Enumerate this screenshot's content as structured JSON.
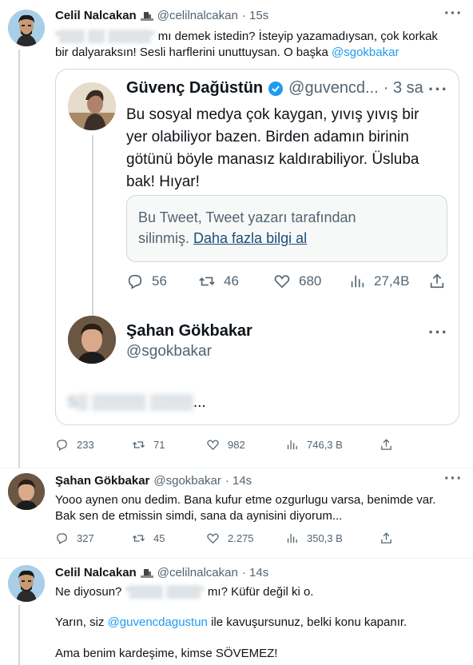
{
  "tweet1": {
    "name": "Celil Nalcakan",
    "handle": "@celilnalcakan",
    "time": "· 15s",
    "text_quote_blur": "“▒▒▒ ▒▒ ▒▒▒▒▒”",
    "text_part1": " mı demek istedin? İsteyip yazamadıysan, çok korkak",
    "text_part2": "bir dalyaraksın! Sesli harflerini unuttuysan. O başka ",
    "mention": "@sgokbakar",
    "stats": {
      "replies": "233",
      "retweets": "71",
      "likes": "982",
      "views": "746,3 B"
    }
  },
  "quoted": {
    "name": "Güvenç Dağüstün",
    "handle": "@guvencd...",
    "time": "· 3 sa",
    "text_lines": [
      "Bu sosyal medya çok kaygan, yıvış yıvış bir",
      "yer olabiliyor bazen. Birden adamın birinin",
      "götünü böyle manasız kaldırabiliyor. Üsluba",
      "bak! Hıyar!"
    ],
    "deleted_line1": "Bu Tweet, Tweet yazarı tarafından",
    "deleted_line2": "silinmiş. ",
    "deleted_link": "Daha fazla bilgi al",
    "stats": {
      "replies": "56",
      "retweets": "46",
      "likes": "680",
      "views": "27,4B"
    },
    "reply_name": "Şahan Gökbakar",
    "reply_handle": "@sgokbakar",
    "reply_text_blur": "S▒ ▒▒▒▒▒ ▒▒▒▒",
    "reply_text_end": "..."
  },
  "tweet2": {
    "name": "Şahan Gökbakar",
    "handle": "@sgokbakar",
    "time": "· 14s",
    "lines": [
      "Yooo aynen onu dedim. Bana kufur etme ozgurlugu varsa, benimde var.",
      "Bak sen de etmissin simdi, sana da aynisini diyorum..."
    ],
    "stats": {
      "replies": "327",
      "retweets": "45",
      "likes": "2.275",
      "views": "350,3 B"
    }
  },
  "tweet3": {
    "name": "Celil Nalcakan",
    "handle": "@celilnalcakan",
    "time": "· 14s",
    "line1_start": "Ne diyosun? ",
    "line1_blur": "“▒▒▒▒ ▒▒▒▒”",
    "line1_end": " mı? Küfür değil ki o.",
    "line2_start": "Yarın, siz ",
    "line2_mention": "@guvencdagustun",
    "line2_end": " ile kavuşursunuz, belki konu kapanır.",
    "line3": "Ama benim kardeşime, kimse SÖVEMEZ!"
  },
  "icons": {
    "more": "more-icon",
    "reply": "reply-icon",
    "retweet": "retweet-icon",
    "like": "like-icon",
    "views": "views-icon",
    "share": "share-icon",
    "verified": "verified-badge-icon",
    "flag": "flag-emoji-icon"
  },
  "colors": {
    "accent": "#1d9bf0",
    "text": "#0f1419",
    "muted": "#536471",
    "border": "#cfd9de"
  }
}
